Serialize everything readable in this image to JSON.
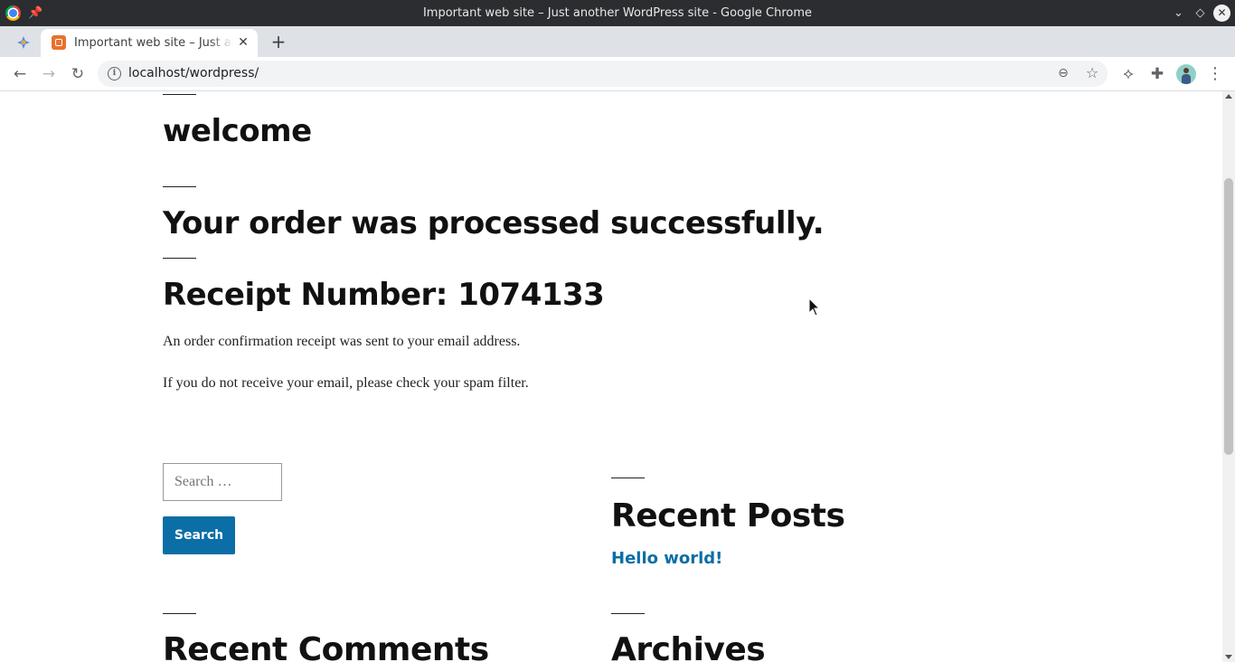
{
  "window": {
    "title": "Important web site – Just another WordPress site - Google Chrome",
    "controls": {
      "minimize": "⌄",
      "maximize": "◇",
      "close": "✕"
    }
  },
  "tabs": {
    "active_title": "Important web site – Just another WordPress site",
    "close_glyph": "✕",
    "new_tab_glyph": "+"
  },
  "toolbar": {
    "back_glyph": "←",
    "forward_glyph": "→",
    "reload_glyph": "↻",
    "info_glyph": "i",
    "url": "localhost/wordpress/",
    "zoom_glyph": "⊖",
    "star_glyph": "☆",
    "ext1_glyph": "⟡",
    "ext2_glyph": "✚",
    "menu_glyph": "⋮"
  },
  "page": {
    "heading_welcome": "welcome",
    "heading_success": "Your order was processed successfully.",
    "heading_receipt": "Receipt Number: 1074133",
    "para_confirmation": "An order confirmation receipt was sent to your email address.",
    "para_spam": "If you do not receive your email, please check your spam filter.",
    "search": {
      "placeholder": "Search …",
      "button_label": "Search"
    },
    "recent_posts": {
      "heading": "Recent Posts",
      "items": [
        "Hello world!"
      ]
    },
    "recent_comments": {
      "heading": "Recent Comments"
    },
    "archives": {
      "heading": "Archives"
    }
  },
  "colors": {
    "link": "#0b6ea6",
    "button": "#0b6ea6",
    "text": "#111111",
    "titlebar": "#2b2d30",
    "tabstrip": "#dee1e6"
  }
}
